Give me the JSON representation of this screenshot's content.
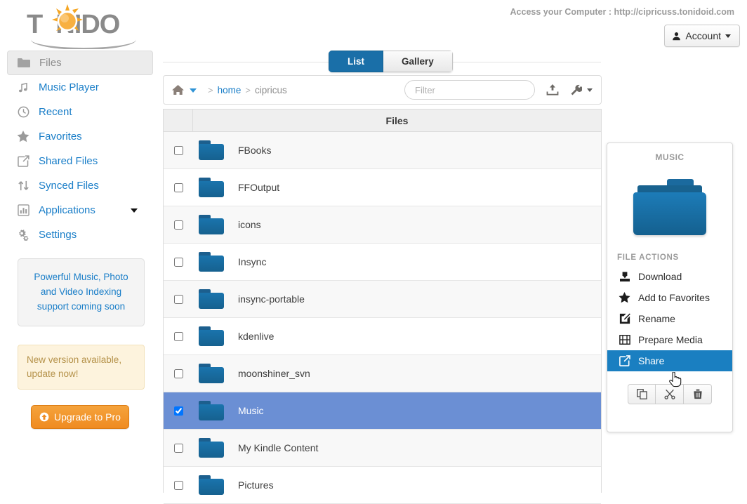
{
  "header": {
    "logo_text": "T NIDO",
    "logo_prefix": "T",
    "logo_suffix": "NIDO",
    "access_line": "Access your Computer : http://cipricuss.tonidoid.com",
    "account_label": "Account",
    "account_icon": "user-icon"
  },
  "sidebar": {
    "items": [
      {
        "label": "Files",
        "icon": "folder-icon",
        "active": true
      },
      {
        "label": "Music Player",
        "icon": "music-note-icon",
        "active": false
      },
      {
        "label": "Recent",
        "icon": "clock-icon",
        "active": false
      },
      {
        "label": "Favorites",
        "icon": "star-icon",
        "active": false
      },
      {
        "label": "Shared Files",
        "icon": "share-icon",
        "active": false
      },
      {
        "label": "Synced Files",
        "icon": "sync-arrows-icon",
        "active": false
      },
      {
        "label": "Applications",
        "icon": "bar-chart-icon",
        "active": false,
        "has_caret": true
      },
      {
        "label": "Settings",
        "icon": "gears-icon",
        "active": false
      }
    ],
    "promo_text": "Powerful Music, Photo and Video Indexing support coming soon",
    "alert_text": "New version available, update now!",
    "upgrade_label": "Upgrade to Pro",
    "upgrade_icon": "arrow-up-circle-icon"
  },
  "main": {
    "tabs": [
      {
        "label": "List",
        "active": true
      },
      {
        "label": "Gallery",
        "active": false
      }
    ],
    "breadcrumb": {
      "home_icon": "home-icon",
      "separator": ">",
      "crumbs": [
        {
          "label": "home",
          "current": false
        },
        {
          "label": "cipricus",
          "current": true
        }
      ]
    },
    "filter_placeholder": "Filter",
    "filter_value": "",
    "upload_icon": "upload-icon",
    "settings_icon": "wrench-icon",
    "column_header": "Files",
    "files": [
      {
        "name": "FBooks",
        "selected": false
      },
      {
        "name": "FFOutput",
        "selected": false
      },
      {
        "name": "icons",
        "selected": false
      },
      {
        "name": "Insync",
        "selected": false
      },
      {
        "name": "insync-portable",
        "selected": false
      },
      {
        "name": "kdenlive",
        "selected": false
      },
      {
        "name": "moonshiner_svn",
        "selected": false
      },
      {
        "name": "Music",
        "selected": true
      },
      {
        "name": "My Kindle Content",
        "selected": false
      },
      {
        "name": "Pictures",
        "selected": false
      }
    ]
  },
  "details_panel": {
    "title": "MUSIC",
    "preview_icon": "folder-large-icon",
    "section_label": "FILE ACTIONS",
    "actions": [
      {
        "label": "Download",
        "icon": "download-icon",
        "highlighted": false
      },
      {
        "label": "Add to Favorites",
        "icon": "star-icon",
        "highlighted": false
      },
      {
        "label": "Rename",
        "icon": "pencil-square-icon",
        "highlighted": false
      },
      {
        "label": "Prepare Media",
        "icon": "film-icon",
        "highlighted": false
      },
      {
        "label": "Share",
        "icon": "share-icon",
        "highlighted": true
      }
    ],
    "buttons": [
      {
        "name": "copy",
        "icon": "copy-icon"
      },
      {
        "name": "cut",
        "icon": "scissors-icon"
      },
      {
        "name": "delete",
        "icon": "trash-icon"
      }
    ]
  },
  "colors": {
    "accent_blue": "#1a7ec8",
    "tab_active": "#1a6fa8",
    "row_selected": "#6b8fd4",
    "action_highlight": "#1a7fc1",
    "folder_blue": "#1a74ad",
    "upgrade_orange": "#ef8b21",
    "alert_text": "#b5924a"
  }
}
